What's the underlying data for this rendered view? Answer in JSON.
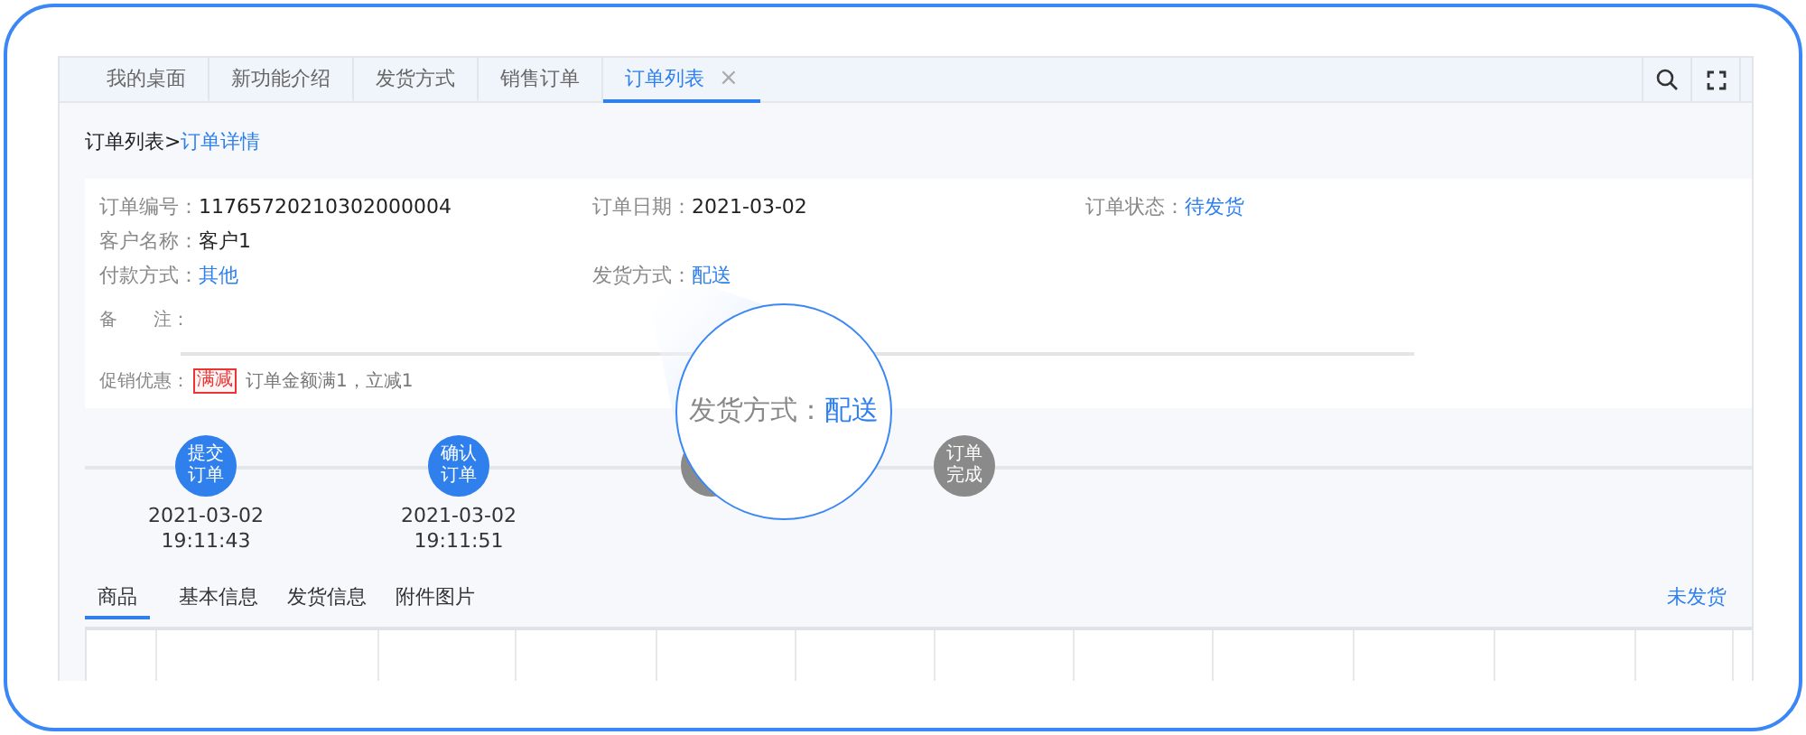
{
  "tabs": [
    {
      "label": "我的桌面",
      "selected": false
    },
    {
      "label": "新功能介绍",
      "selected": false
    },
    {
      "label": "发货方式",
      "selected": false
    },
    {
      "label": "销售订单",
      "selected": false
    },
    {
      "label": "订单列表",
      "selected": true,
      "close": "×"
    }
  ],
  "breadcrumb": {
    "parent": "订单列表",
    "separator": ">",
    "current": "订单详情"
  },
  "order": {
    "fields": [
      {
        "label": "订单编号：",
        "value": "11765720210302000004",
        "kind": "text"
      },
      {
        "label": "订单日期：",
        "value": "2021-03-02",
        "kind": "text"
      },
      {
        "label": "订单状态：",
        "value": "待发货",
        "kind": "link"
      },
      {
        "label": "客户名称：",
        "value": "客户1",
        "kind": "text"
      },
      {
        "label": "付款方式：",
        "value": "其他",
        "kind": "link"
      },
      {
        "label": "发货方式：",
        "value": "配送",
        "kind": "link"
      }
    ],
    "remark": {
      "label": "备　　注："
    },
    "promotion": {
      "label": "促销优惠：",
      "tag": "满减",
      "text": "订单金额满1，立减1"
    }
  },
  "steps": [
    {
      "label": "提交订单",
      "done": true,
      "date": "2021-03-02",
      "time": "19:11:43"
    },
    {
      "label": "确认订单",
      "done": true,
      "date": "2021-03-02",
      "time": "19:11:51"
    },
    {
      "done": false
    },
    {
      "label": "订单完成",
      "done": false
    }
  ],
  "detail_tabs": [
    {
      "label": "商品",
      "selected": true
    },
    {
      "label": "基本信息",
      "selected": false
    },
    {
      "label": "发货信息",
      "selected": false
    },
    {
      "label": "附件图片",
      "selected": false
    }
  ],
  "shipping_status": "未发货",
  "magnifier": {
    "label": "发货方式：",
    "value": "配送"
  }
}
